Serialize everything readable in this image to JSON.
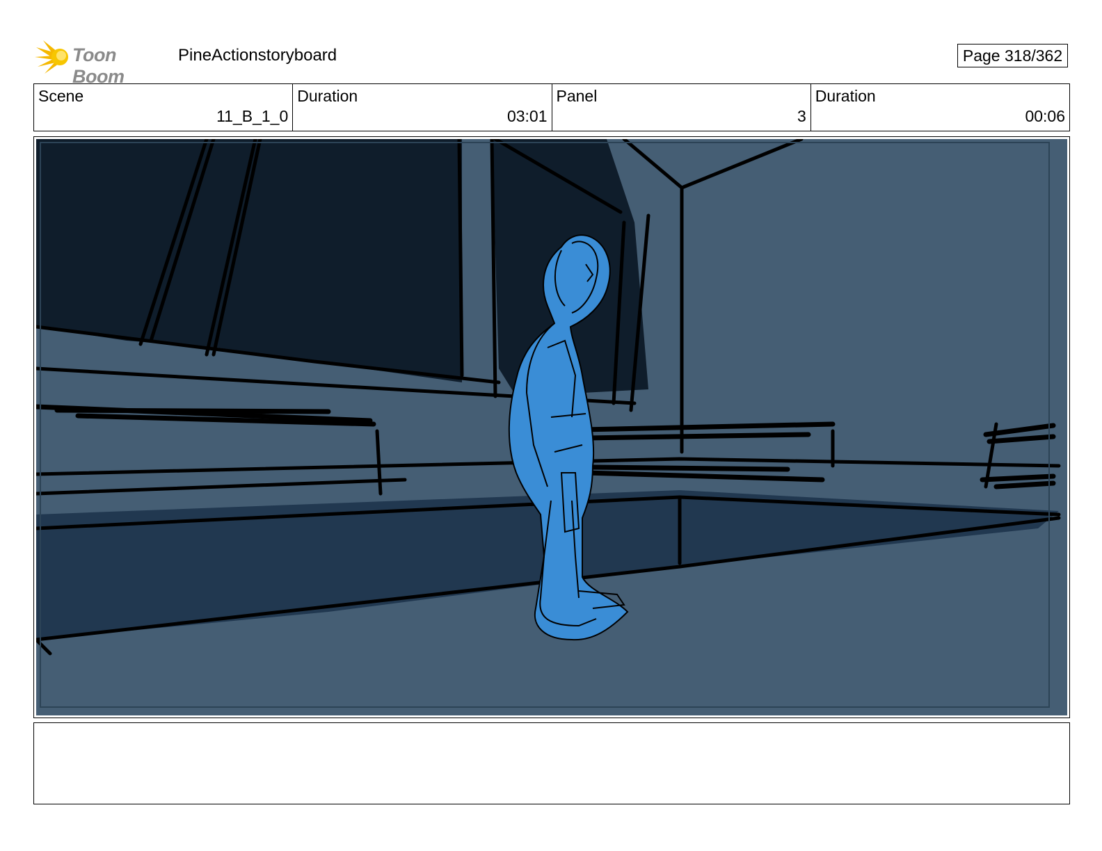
{
  "header": {
    "logo_text": "Toon Boom",
    "logo_icon": "sunburst-logo-icon",
    "project_title": "PineActionstoryboard",
    "page_label": "Page 318/362"
  },
  "info": {
    "scene_label": "Scene",
    "scene_value": "11_B_1_0",
    "scene_duration_label": "Duration",
    "scene_duration_value": "03:01",
    "panel_label": "Panel",
    "panel_value": "3",
    "panel_duration_label": "Duration",
    "panel_duration_value": "00:06"
  },
  "panel": {
    "description": "",
    "colors": {
      "wall": "#455e74",
      "dark_window": "#0f1d2b",
      "floor_shadow": "#213850",
      "character": "#3a8dd6",
      "line": "#000000"
    }
  },
  "notes": {
    "text": ""
  }
}
